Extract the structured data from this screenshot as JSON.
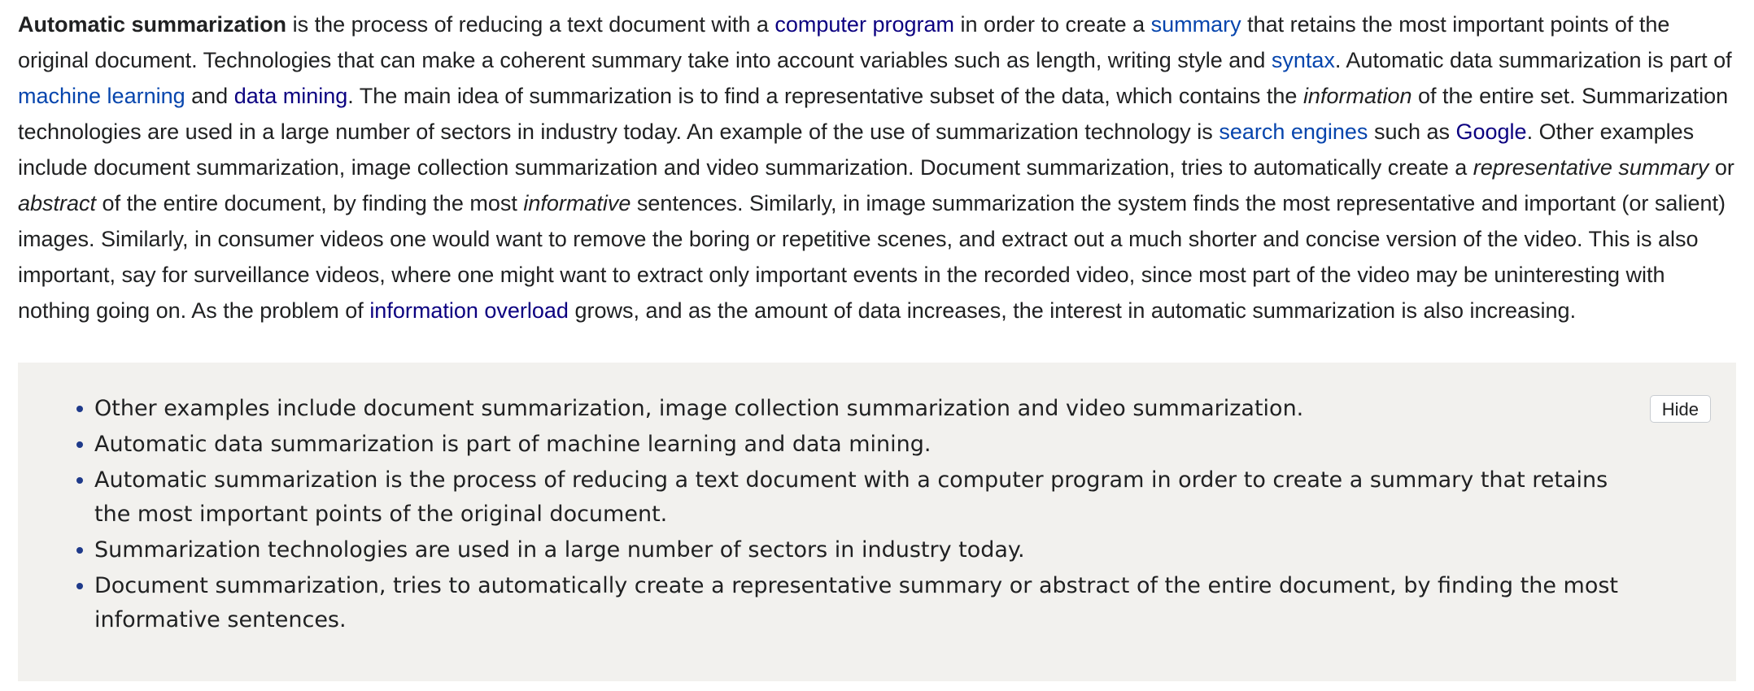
{
  "article": {
    "bold_term": "Automatic summarization",
    "t1": " is the process of reducing a text document with a ",
    "link_computer_program": "computer program",
    "t2": " in order to create a ",
    "link_summary": "summary",
    "t3": " that retains the most important points of the original document. Technologies that can make a coherent summary take into account variables such as length, writing style and ",
    "link_syntax": "syntax",
    "t4": ". Automatic data summarization is part of ",
    "link_machine_learning": "machine learning",
    "t5": " and ",
    "link_data_mining": "data mining",
    "t6": ". The main idea of summarization is to find a representative subset of the data, which contains the ",
    "italic_information": "information",
    "t7": " of the entire set. Summarization technologies are used in a large number of sectors in industry today. An example of the use of summarization technology is ",
    "link_search_engines": "search engines",
    "t8": " such as ",
    "link_google": "Google",
    "t9": ". Other examples include document summarization, image collection summarization and video summarization. Document summarization, tries to automatically create a ",
    "italic_representative_summary": "representative summary",
    "t10": " or ",
    "italic_abstract": "abstract",
    "t11": " of the entire document, by finding the most ",
    "italic_informative": "informative",
    "t12": " sentences. Similarly, in image summarization the system finds the most representative and important (or salient) images. Similarly, in consumer videos one would want to remove the boring or repetitive scenes, and extract out a much shorter and concise version of the video. This is also important, say for surveillance videos, where one might want to extract only important events in the recorded video, since most part of the video may be uninteresting with nothing going on. As the problem of ",
    "link_information_overload": "information overload",
    "t13": " grows, and as the amount of data increases, the interest in automatic summarization is also increasing."
  },
  "summary_panel": {
    "hide_label": "Hide",
    "items": [
      "Other examples include document summarization, image collection summarization and video summarization.",
      "Automatic data summarization is part of machine learning and data mining.",
      "Automatic summarization is the process of reducing a text document with a computer program in order to create a summary that retains the most important points of the original document.",
      "Summarization technologies are used in a large number of sectors in industry today.",
      "Document summarization, tries to automatically create a representative summary or abstract of the entire document, by finding the most informative sentences."
    ]
  },
  "colors": {
    "link": "#0645ad",
    "link_visited": "#0b0080",
    "text": "#202122",
    "panel_background": "#f2f1ee",
    "bullet": "#1f3a8a"
  }
}
